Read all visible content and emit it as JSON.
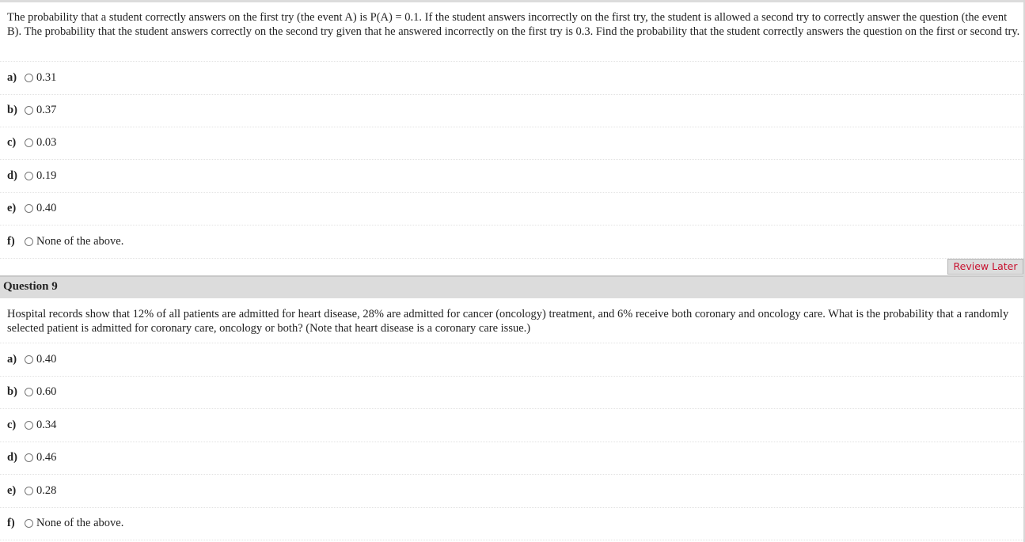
{
  "question8": {
    "text": "The probability that a student correctly answers on the first try (the event A) is P(A) = 0.1. If the student answers incorrectly on the first try, the student is allowed a second try to correctly answer the question (the event B). The probability that the student answers correctly on the second try given that he answered incorrectly on the first try is 0.3. Find the probability that the student correctly answers the question on the first or second try.",
    "options": [
      {
        "letter": "a)",
        "value": "0.31"
      },
      {
        "letter": "b)",
        "value": "0.37"
      },
      {
        "letter": "c)",
        "value": "0.03"
      },
      {
        "letter": "d)",
        "value": "0.19"
      },
      {
        "letter": "e)",
        "value": "0.40"
      },
      {
        "letter": "f)",
        "value": "None of the above."
      }
    ],
    "review_label": "Review Later"
  },
  "question9": {
    "header": "Question 9",
    "text": "Hospital records show that 12% of all patients are admitted for heart disease, 28% are admitted for cancer (oncology) treatment, and 6% receive both coronary and oncology care. What is the probability that a randomly selected patient is admitted for coronary care, oncology or both? (Note that heart disease is a coronary care issue.)",
    "options": [
      {
        "letter": "a)",
        "value": "0.40"
      },
      {
        "letter": "b)",
        "value": "0.60"
      },
      {
        "letter": "c)",
        "value": "0.34"
      },
      {
        "letter": "d)",
        "value": "0.46"
      },
      {
        "letter": "e)",
        "value": "0.28"
      },
      {
        "letter": "f)",
        "value": "None of the above."
      }
    ]
  },
  "colors": {
    "review_text": "#c8102e",
    "header_bg": "#dcdcdc"
  }
}
